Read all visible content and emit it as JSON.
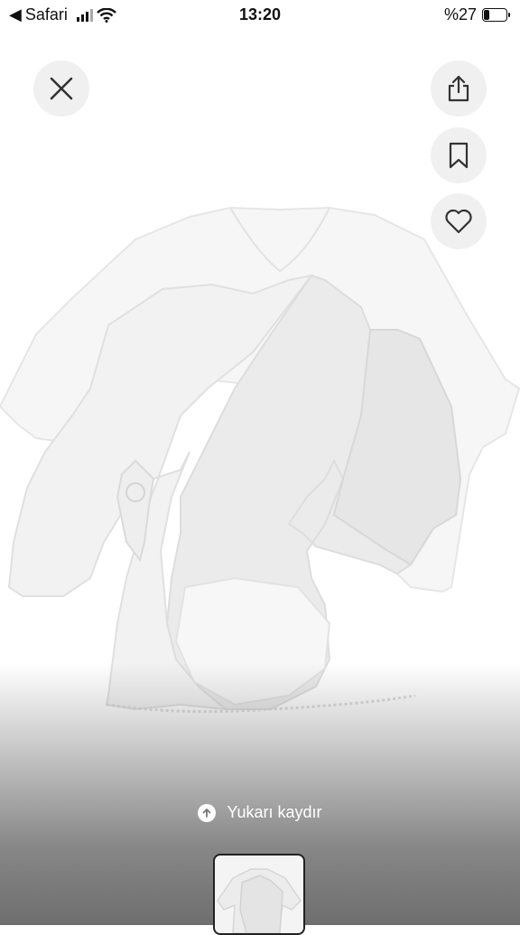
{
  "status_bar": {
    "back_app": "Safari",
    "time": "13:20",
    "battery": "%27",
    "battery_level": 0.27
  },
  "icons": {
    "close": "close-icon",
    "share": "share-icon",
    "bookmark": "bookmark-icon",
    "favorite": "heart-icon",
    "swipe_up": "arrow-up-icon"
  },
  "swipe_hint": {
    "label": "Yukarı kaydır"
  },
  "colors": {
    "button_bg": "#f0f0f0",
    "icon": "#333333",
    "hint_text": "#ffffff"
  }
}
